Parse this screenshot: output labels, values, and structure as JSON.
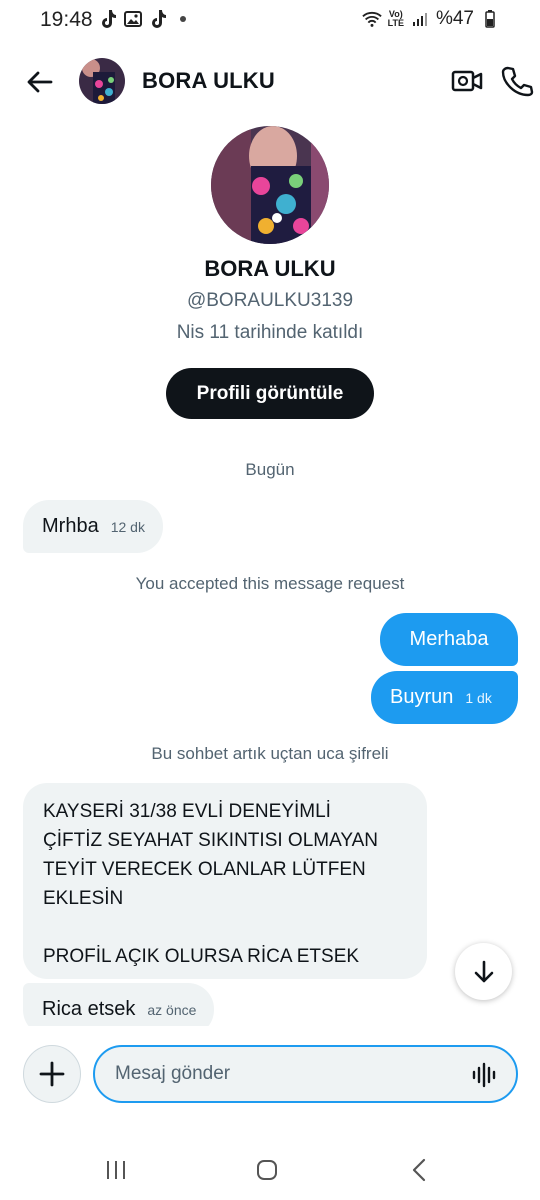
{
  "status": {
    "time": "19:48",
    "battery": "%47",
    "icons": [
      "tiktok-icon",
      "gallery-icon",
      "tiktok-icon",
      "dot-icon",
      "wifi-icon",
      "volte-icon",
      "signal-icon",
      "battery-icon"
    ]
  },
  "header": {
    "name": "BORA ULKU"
  },
  "profile": {
    "name": "BORA ULKU",
    "handle": "@BORAULKU3139",
    "joined": "Nis 11 tarihinde katıldı",
    "view_profile_label": "Profili görüntüle"
  },
  "notes": {
    "today": "Bugün",
    "accepted": "You accepted this message request",
    "encrypted": "Bu sohbet artık uçtan uca şifreli"
  },
  "messages": [
    {
      "dir": "in",
      "text": "Mrhba",
      "time": "12 dk"
    },
    {
      "dir": "out",
      "text": "Merhaba",
      "time": ""
    },
    {
      "dir": "out",
      "text": "Buyrun",
      "time": "1 dk"
    },
    {
      "dir": "in",
      "text": "KAYSERİ 31/38 EVLİ DENEYİMLİ\nÇİFTİZ SEYAHAT SIKINTISI OLMAYAN\nTEYİT VERECEK OLANLAR LÜTFEN\nEKLESİN\n\nPROFİL AÇIK OLURSA RİCA ETSEK",
      "time": ""
    },
    {
      "dir": "in",
      "text": "Rica etsek",
      "time": "az önce"
    }
  ],
  "composer": {
    "placeholder": "Mesaj gönder"
  },
  "colors": {
    "accent": "#1d9bf0",
    "incoming_bubble": "#eff3f4",
    "text_primary": "#0f1419",
    "text_secondary": "#536471"
  }
}
